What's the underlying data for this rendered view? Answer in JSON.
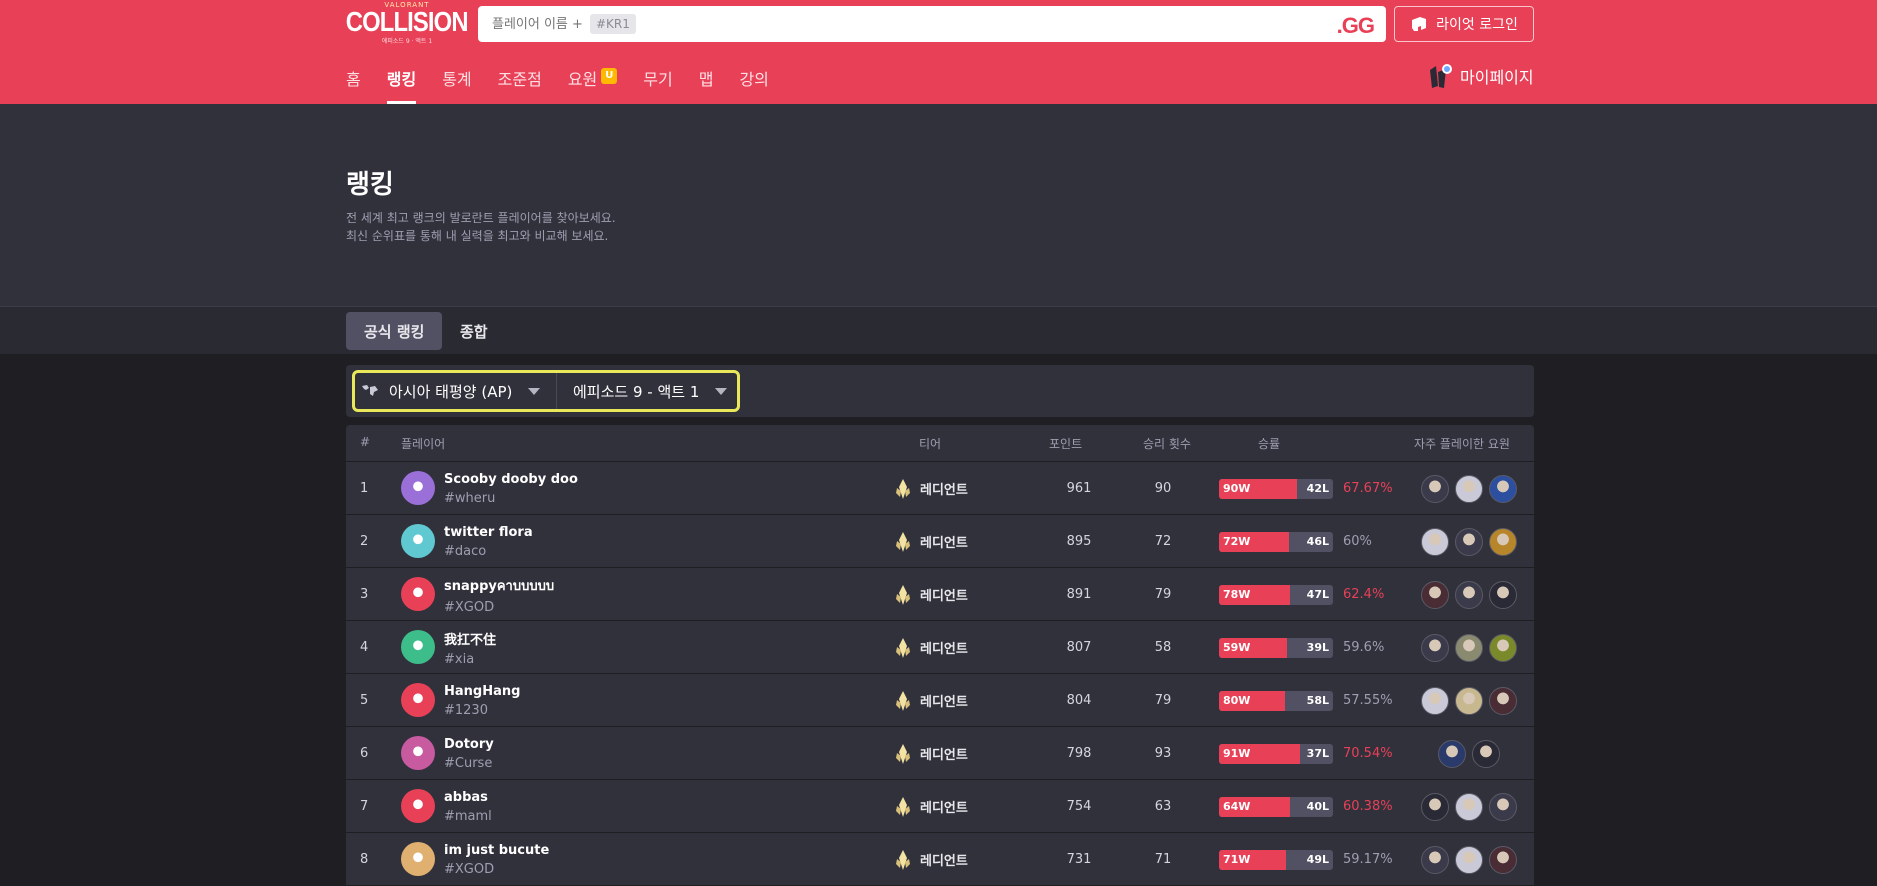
{
  "header": {
    "logo_top": "VALORANT",
    "logo_main": "COLLISION",
    "logo_sub": "에피소드 9 · 액트 1",
    "search_placeholder": "플레이어 이름 +",
    "search_tag": "#KR1",
    "search_brand": ".GG",
    "login_label": "라이엇 로그인",
    "mypage_label": "마이페이지",
    "brand_color": "#e84057"
  },
  "nav": {
    "items": [
      "홈",
      "랭킹",
      "통계",
      "조준점",
      "요원",
      "무기",
      "맵",
      "강의"
    ],
    "active": "랭킹",
    "badge": "U"
  },
  "hero": {
    "title": "랭킹",
    "desc1": "전 세계 최고 랭크의 발로란트 플레이어를 찾아보세요.",
    "desc2": "최신 순위표를 통해 내 실력을 최고와 비교해 보세요."
  },
  "tabs": {
    "official": "공식 랭킹",
    "overall": "종합"
  },
  "filters": {
    "region": "아시아 태평양 (AP)",
    "episode": "에피소드 9 - 액트 1"
  },
  "table": {
    "headers": {
      "rank": "#",
      "player": "플레이어",
      "tier": "티어",
      "points": "포인트",
      "wins": "승리 횟수",
      "winrate": "승률",
      "agents": "자주 플레이한 요원"
    },
    "rows": [
      {
        "rank": "1",
        "name": "Scooby dooby doo",
        "tag": "#wheru",
        "tier": "레디언트",
        "points": "961",
        "wins": "90",
        "w": "90W",
        "l": "42L",
        "win_fraction": 0.68,
        "rate": "67.67%",
        "high": true,
        "avatar_color": "#9a6fd8",
        "agent_colors": [
          "#3a3a4a",
          "#c9c9d8",
          "#2c4fa0"
        ]
      },
      {
        "rank": "2",
        "name": "twitter flora",
        "tag": "#daco",
        "tier": "레디언트",
        "points": "895",
        "wins": "72",
        "w": "72W",
        "l": "46L",
        "win_fraction": 0.61,
        "rate": "60%",
        "high": false,
        "avatar_color": "#5fc8d0",
        "agent_colors": [
          "#c9c9d8",
          "#3a3a4a",
          "#b8862a"
        ]
      },
      {
        "rank": "3",
        "name": "snappyคาบบบบบ",
        "tag": "#XGOD",
        "tier": "레디언트",
        "points": "891",
        "wins": "79",
        "w": "78W",
        "l": "47L",
        "win_fraction": 0.62,
        "rate": "62.4%",
        "high": true,
        "avatar_color": "#e84057",
        "agent_colors": [
          "#4a2c34",
          "#3a3a4a",
          "#2a2a36"
        ]
      },
      {
        "rank": "4",
        "name": "我扛不住",
        "tag": "#xia",
        "tier": "레디언트",
        "points": "807",
        "wins": "58",
        "w": "59W",
        "l": "39L",
        "win_fraction": 0.6,
        "rate": "59.6%",
        "high": false,
        "avatar_color": "#3dbd8a",
        "agent_colors": [
          "#3a3a4a",
          "#8a8a70",
          "#7a8a2a"
        ]
      },
      {
        "rank": "5",
        "name": "HangHang",
        "tag": "#1230",
        "tier": "레디언트",
        "points": "804",
        "wins": "79",
        "w": "80W",
        "l": "58L",
        "win_fraction": 0.58,
        "rate": "57.55%",
        "high": false,
        "avatar_color": "#e84057",
        "agent_colors": [
          "#c9c9d8",
          "#c8b890",
          "#4a2c34"
        ]
      },
      {
        "rank": "6",
        "name": "Dotory",
        "tag": "#Curse",
        "tier": "레디언트",
        "points": "798",
        "wins": "93",
        "w": "91W",
        "l": "37L",
        "win_fraction": 0.71,
        "rate": "70.54%",
        "high": true,
        "avatar_color": "#c85aa0",
        "agent_colors": [
          "#2a3a6a",
          "#2a2a36"
        ]
      },
      {
        "rank": "7",
        "name": "abbas",
        "tag": "#maml",
        "tier": "레디언트",
        "points": "754",
        "wins": "63",
        "w": "64W",
        "l": "40L",
        "win_fraction": 0.62,
        "rate": "60.38%",
        "high": true,
        "avatar_color": "#e84057",
        "agent_colors": [
          "#2a2a36",
          "#c9c9d8",
          "#3a3a4a"
        ]
      },
      {
        "rank": "8",
        "name": "im just bucute",
        "tag": "#XGOD",
        "tier": "레디언트",
        "points": "731",
        "wins": "71",
        "w": "71W",
        "l": "49L",
        "win_fraction": 0.59,
        "rate": "59.17%",
        "high": false,
        "avatar_color": "#e0b070",
        "agent_colors": [
          "#3a3a4a",
          "#c9c9d8",
          "#4a2c34"
        ]
      }
    ]
  }
}
